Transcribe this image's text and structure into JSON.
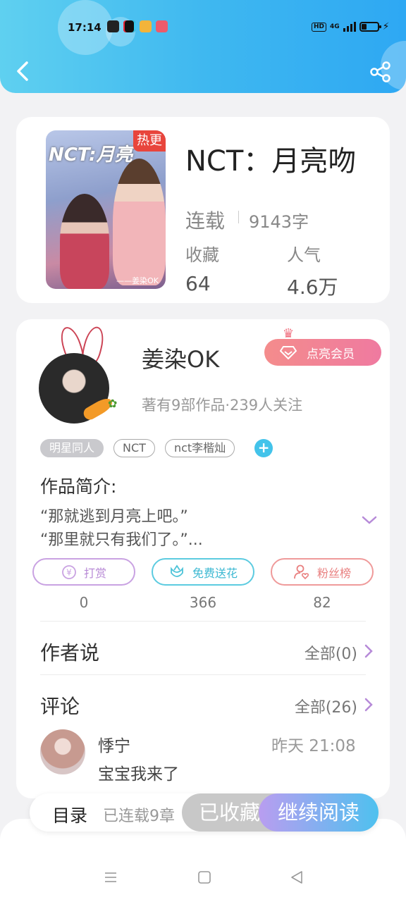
{
  "status_bar": {
    "time": "17:14",
    "hd": "HD",
    "network": "4G"
  },
  "header": {
    "back_icon": "chevron-left-icon",
    "share_icon": "share-icon",
    "colors": {
      "gradient_start": "#5fd0f0",
      "gradient_end": "#2ea8f3"
    }
  },
  "book": {
    "cover_title": "NCT:月亮",
    "hot_tag": "热更",
    "cover_author": "——姜染OK",
    "title": "NCT：月亮吻",
    "serial_status": "连载",
    "word_count": "9143字",
    "favorites_label": "收藏",
    "favorites_value": "64",
    "popularity_label": "人气",
    "popularity_value": "4.6万"
  },
  "author": {
    "name": "姜染OK",
    "info": "著有9部作品·239人关注",
    "vip_label": "点亮会员",
    "tags": [
      "明星同人",
      "NCT",
      "nct李楷灿"
    ]
  },
  "intro": {
    "title": "作品简介:",
    "line1": "“那就逃到月亮上吧。”",
    "line2": "“那里就只有我们了。”..."
  },
  "actions": [
    {
      "label": "打赏",
      "count": "0",
      "icon": "yen-icon",
      "color": "#c08fd8"
    },
    {
      "label": "免费送花",
      "count": "366",
      "icon": "flower-icon",
      "color": "#4cc3d8"
    },
    {
      "label": "粉丝榜",
      "count": "82",
      "icon": "user-heart-icon",
      "color": "#e98080"
    }
  ],
  "author_says": {
    "title": "作者说",
    "link": "全部(0)"
  },
  "comments": {
    "title": "评论",
    "link": "全部(26)",
    "items": [
      {
        "user": "悸宁",
        "time": "昨天 21:08",
        "text": "宝宝我来了"
      }
    ]
  },
  "bottom_bar": {
    "toc_label": "目录",
    "toc_sub": "已连载9章",
    "fav_label": "已收藏",
    "read_label": "继续阅读"
  },
  "nav": {
    "menu_icon": "menu-icon",
    "home_icon": "square-icon",
    "back_icon": "triangle-back-icon"
  }
}
